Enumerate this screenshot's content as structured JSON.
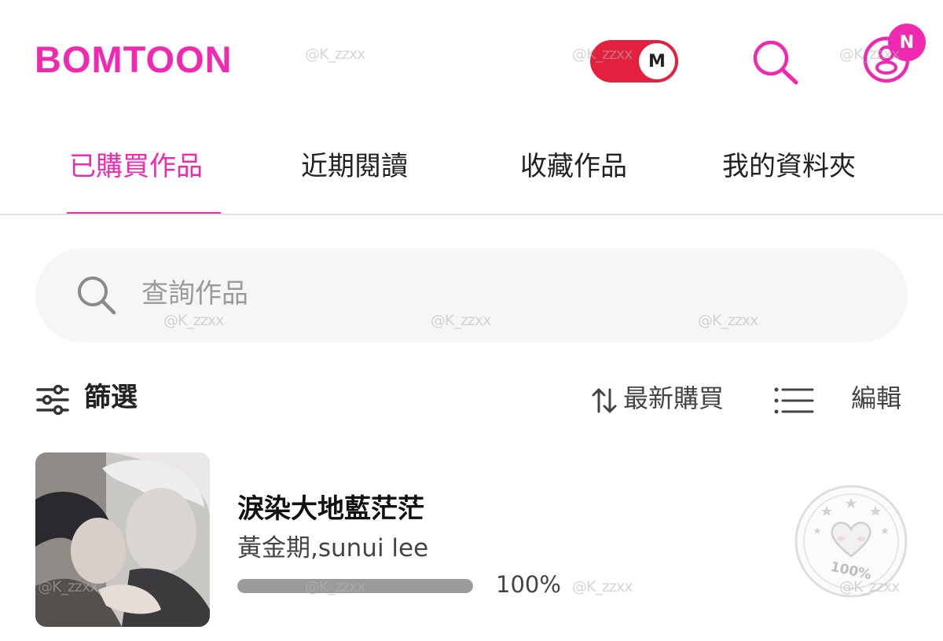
{
  "header": {
    "logo": "BOMTOON",
    "mode_toggle_label": "M",
    "notification_badge": "N"
  },
  "tabs": [
    {
      "label": "已購買作品",
      "active": true
    },
    {
      "label": "近期閱讀",
      "active": false
    },
    {
      "label": "收藏作品",
      "active": false
    },
    {
      "label": "我的資料夾",
      "active": false
    }
  ],
  "search": {
    "placeholder": "查詢作品"
  },
  "toolbar": {
    "filter_label": "篩選",
    "sort_label": "最新購買",
    "edit_label": "編輯"
  },
  "library": [
    {
      "title": "淚染大地藍茫茫",
      "author": "黃金期,sunui lee",
      "progress_value": 100,
      "progress_text": "100%",
      "stamp_text": "100%"
    }
  ],
  "watermark_text": "@K_zzxx",
  "colors": {
    "brand": "#f02ab0",
    "toggle": "#e3203d",
    "progress": "#9b9b9b"
  },
  "icons": {
    "search": "search-icon",
    "profile": "profile-icon",
    "filter": "filter-icon",
    "sort": "sort-icon",
    "list_view": "list-view-icon"
  }
}
